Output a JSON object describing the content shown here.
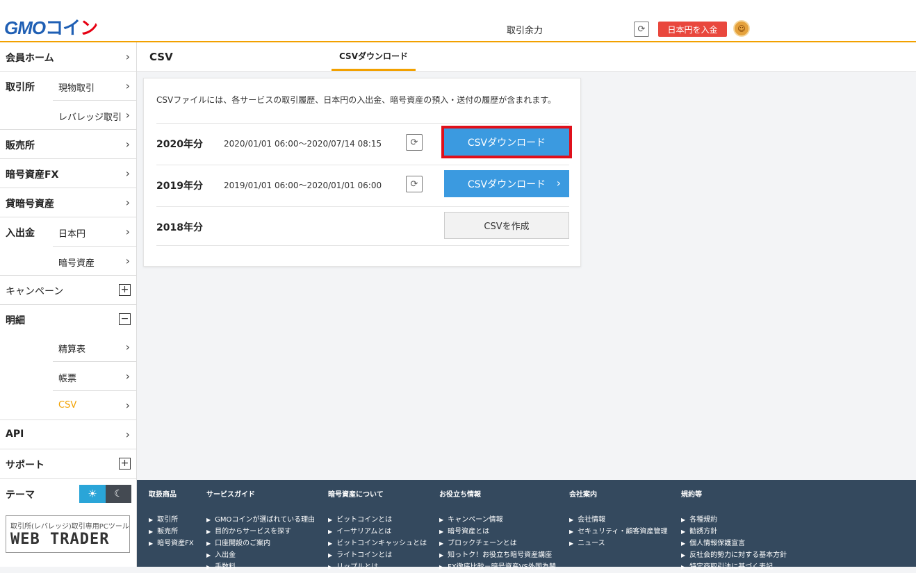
{
  "header": {
    "logo_gmo": "GMO",
    "logo_coin": "コイ",
    "logo_n": "ン",
    "balance_label": "取引余力",
    "deposit_button": "日本円を入金"
  },
  "sidebar": {
    "member_home": "会員ホーム",
    "exchange": "取引所",
    "spot": "現物取引",
    "leverage": "レバレッジ取引",
    "sales": "販売所",
    "crypto_fx": "暗号資産FX",
    "lending": "貸暗号資産",
    "deposit": "入出金",
    "jpy": "日本円",
    "crypto": "暗号資産",
    "campaign": "キャンペーン",
    "details": "明細",
    "settlement": "精算表",
    "ledger": "帳票",
    "csv": "CSV",
    "api": "API",
    "support": "サポート",
    "theme": "テーマ",
    "webtrader_sub": "取引所(レバレッジ)取引専用PCツール",
    "webtrader_main": "WEB TRADER"
  },
  "topbar": {
    "title": "CSV",
    "tab": "CSVダウンロード"
  },
  "card": {
    "description": "CSVファイルには、各サービスの取引履歴、日本円の入出金、暗号資産の預入・送付の履歴が含まれます。",
    "rows": [
      {
        "year": "2020年分",
        "range": "2020/01/01 06:00～2020/07/14 08:15",
        "button": "CSVダウンロード"
      },
      {
        "year": "2019年分",
        "range": "2019/01/01 06:00～2020/01/01 06:00",
        "button": "CSVダウンロード"
      },
      {
        "year": "2018年分",
        "range": "",
        "button": "CSVを作成"
      }
    ]
  },
  "footer": {
    "col1": {
      "head": "取扱商品",
      "items": [
        "取引所",
        "販売所",
        "暗号資産FX"
      ]
    },
    "col2": {
      "head": "サービスガイド",
      "items": [
        "GMOコインが選ばれている理由",
        "目的からサービスを探す",
        "口座開設のご案内",
        "入出金",
        "手数料"
      ]
    },
    "col3": {
      "head": "暗号資産について",
      "items": [
        "ビットコインとは",
        "イーサリアムとは",
        "ビットコインキャッシュとは",
        "ライトコインとは",
        "リップルとは"
      ]
    },
    "col4": {
      "head": "お役立ち情報",
      "items": [
        "キャンペーン情報",
        "暗号資産とは",
        "ブロックチェーンとは",
        "知っトク！お役立ち暗号資産講座",
        "FX徹底比較－暗号資産VS外国為替"
      ]
    },
    "col5": {
      "head": "会社案内",
      "items": [
        "会社情報",
        "セキュリティ・顧客資産管理",
        "ニュース"
      ]
    },
    "col6": {
      "head": "規約等",
      "items": [
        "各種規約",
        "勧誘方針",
        "個人情報保護宣言",
        "反社会的勢力に対する基本方針",
        "特定商取引法に基づく表記"
      ]
    }
  },
  "colors": {
    "accent": "#f2a100",
    "download_blue": "#3b9ae0",
    "deposit_red": "#e9473d",
    "highlight_red": "#e0101b",
    "footer_bg": "#34495e"
  }
}
